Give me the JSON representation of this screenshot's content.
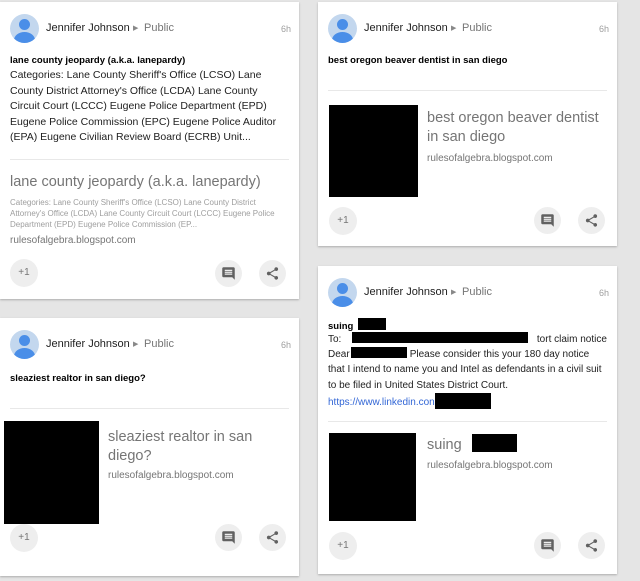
{
  "posts": [
    {
      "author": "Jennifer Johnson",
      "visibility": "Public",
      "time": "6h",
      "title": "lane county jeopardy (a.k.a. lanepardy)",
      "body": "Categories: Lane County Sheriff's Office (LCSO) Lane County District Attorney's Office (LCDA) Lane County Circuit Court (LCCC) Eugene Police Department (EPD) Eugene Police Commission (EPC) Eugene Police Auditor (EPA) Eugene Civilian Review Board (ECRB) Unit...",
      "link_title": "lane county jeopardy (a.k.a. lanepardy)",
      "link_desc": "Categories: Lane County Sheriff's Office (LCSO) Lane County District Attorney's Office (LCDA) Lane County Circuit Court (LCCC) Eugene Police Department (EPD) Eugene Police Commission (EP...",
      "domain": "rulesofalgebra.blogspot.com",
      "plus_label": "+1"
    },
    {
      "author": "Jennifer Johnson",
      "visibility": "Public",
      "time": "6h",
      "title": "best oregon beaver dentist in san diego",
      "link_title": "best oregon beaver dentist in san diego",
      "domain": "rulesofalgebra.blogspot.com",
      "plus_label": "+1"
    },
    {
      "author": "Jennifer Johnson",
      "visibility": "Public",
      "time": "6h",
      "title": "sleaziest realtor in san diego?",
      "link_title": "sleaziest realtor in san diego?",
      "domain": "rulesofalgebra.blogspot.com",
      "plus_label": "+1"
    },
    {
      "author": "Jennifer Johnson",
      "visibility": "Public",
      "time": "6h",
      "title": "suing",
      "to_label": "To:",
      "to_suffix": "tort claim notice",
      "dear_label": "Dear",
      "body_rest": "Please consider this your 180 day notice that I intend to name you and Intel as defendants in a civil suit to be filed in United States District Court.",
      "url": "https://www.linkedin.con",
      "link_title": "suing",
      "domain": "rulesofalgebra.blogspot.com",
      "plus_label": "+1"
    }
  ],
  "icons": {
    "comment": "comment-icon",
    "share": "share-icon",
    "caret": "caret-right-icon"
  },
  "colors": {
    "avatar": "#4a8ee8",
    "link": "#3367d6",
    "background": "#e5e5e5"
  }
}
